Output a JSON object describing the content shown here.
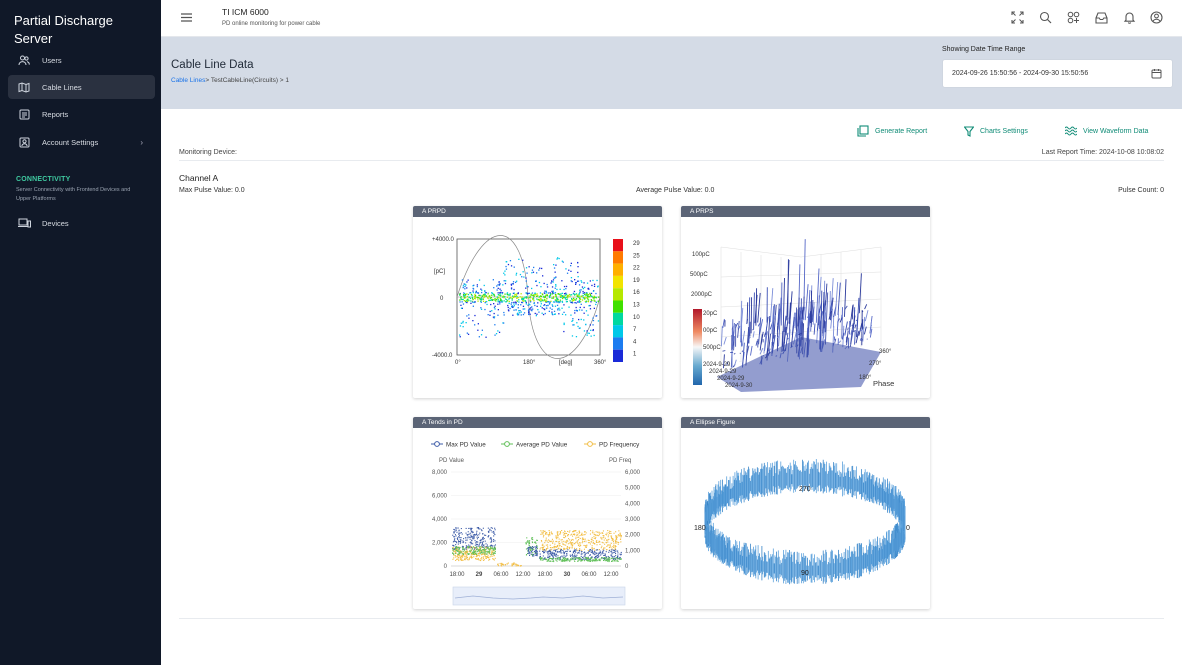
{
  "sidebar": {
    "brand": "Partial Discharge Server",
    "items": [
      {
        "label": "Users",
        "icon": "users-icon"
      },
      {
        "label": "Cable Lines",
        "icon": "map-icon"
      },
      {
        "label": "Reports",
        "icon": "report-icon"
      },
      {
        "label": "Account Settings",
        "icon": "account-icon"
      },
      {
        "label": "Devices",
        "icon": "devices-icon"
      }
    ],
    "connectivity_title": "CONNECTIVITY",
    "connectivity_desc": "Server Connectivity with Frontend Devices and Upper Platforms"
  },
  "topbar": {
    "title": "TI ICM 6000",
    "subtitle": "PD online monitoring for power cable",
    "icons": [
      "fullscreen-icon",
      "search-icon",
      "apps-icon",
      "inbox-icon",
      "bell-icon",
      "user-icon"
    ]
  },
  "header": {
    "title": "Cable Line Data",
    "breadcrumb_link": "Cable Lines",
    "breadcrumb_rest": "> TestCableLine(Circuits) > 1",
    "range_label": "Showing Date Time Range",
    "range_value": "2024-09-26 15:50:56 - 2024-09-30 15:50:56"
  },
  "actions": {
    "generate": "Generate Report",
    "charts": "Charts Settings",
    "waveform": "View Waveform Data"
  },
  "monitor": {
    "device_label": "Monitoring Device:",
    "last_report": "Last Report Time: 2024-10-08 10:08:02",
    "channel": "Channel A",
    "max_pulse": "Max Pulse Value: 0.0",
    "avg_pulse": "Average Pulse Value: 0.0",
    "pulse_count": "Pulse Count: 0"
  },
  "panels": {
    "prpd": "A PRPD",
    "prps": "A PRPS",
    "trends": "A Tends in PD",
    "ellipse": "A Ellipse Figure"
  },
  "chart_data": [
    {
      "type": "scatter",
      "title": "A PRPD",
      "ylabel": "[pC]",
      "xlabel": "[deg]",
      "yticks": [
        "+4000.0",
        "0",
        "-4000.0"
      ],
      "xticks": [
        "0°",
        "180°",
        "360°"
      ],
      "ylim": [
        -4000,
        4000
      ],
      "xlim": [
        0,
        360
      ],
      "colorbar": [
        29,
        25,
        22,
        19,
        16,
        13,
        10,
        7,
        4,
        1
      ],
      "colorbar_colors": [
        "#e8101a",
        "#ff7a00",
        "#ffb000",
        "#f2e400",
        "#b6e800",
        "#40e000",
        "#00d8a0",
        "#00c8e8",
        "#1c7cf0",
        "#1a2ad8"
      ]
    },
    {
      "type": "surface",
      "title": "A PRPS",
      "z_ticks": [
        "100pC",
        "500pC",
        "2000pC",
        "20pC",
        "00pC",
        "500pC"
      ],
      "phase_ticks": [
        "360°",
        "270°",
        "180°"
      ],
      "dates": [
        "2024-9-29",
        "2024-9-29",
        "2024-9-29",
        "2024-9-30"
      ],
      "phase_label": "Phase"
    },
    {
      "type": "line",
      "title": "A Tends in PD",
      "series": [
        {
          "name": "Max PD Value",
          "color": "#3e5ca8"
        },
        {
          "name": "Average PD Value",
          "color": "#62c05a"
        },
        {
          "name": "PD Frequency",
          "color": "#f2be45"
        }
      ],
      "ylabel": "PD Value",
      "y2label": "PD Freq",
      "yticks": [
        "8,000",
        "6,000",
        "4,000",
        "2,000",
        "0"
      ],
      "y2ticks": [
        "6,000",
        "5,000",
        "4,000",
        "3,000",
        "2,000",
        "1,000",
        "0"
      ],
      "xticks": [
        "18:00",
        "29",
        "06:00",
        "12:00",
        "18:00",
        "30",
        "06:00",
        "12:00"
      ]
    },
    {
      "type": "polar",
      "title": "A Ellipse Figure",
      "labels": [
        "270",
        "180",
        "0",
        "90"
      ]
    }
  ]
}
